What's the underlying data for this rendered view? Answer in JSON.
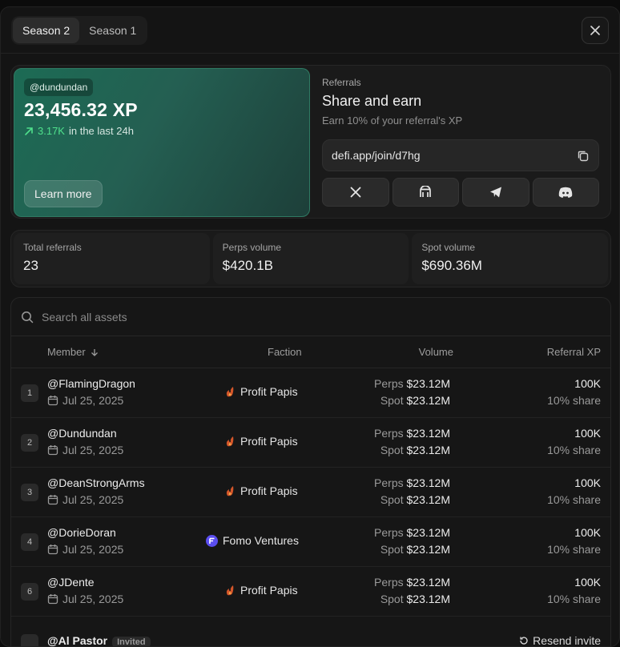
{
  "tabs": [
    {
      "label": "Season 2"
    },
    {
      "label": "Season 1"
    }
  ],
  "xp_card": {
    "handle": "@dundundan",
    "xp": "23,456.32 XP",
    "change_value": "3.17K",
    "change_suffix": "in the last 24h",
    "learn_more": "Learn more"
  },
  "referrals": {
    "label": "Referrals",
    "title": "Share and earn",
    "subtitle": "Earn 10% of your referral's XP",
    "link": "defi.app/join/d7hg",
    "share_icons": [
      "x-icon",
      "gateway-icon",
      "telegram-icon",
      "discord-icon"
    ]
  },
  "stats": [
    {
      "label": "Total referrals",
      "value": "23"
    },
    {
      "label": "Perps volume",
      "value": "$420.1B"
    },
    {
      "label": "Spot volume",
      "value": "$690.36M"
    }
  ],
  "search": {
    "placeholder": "Search all assets"
  },
  "columns": {
    "member": "Member",
    "faction": "Faction",
    "volume": "Volume",
    "xp": "Referral XP"
  },
  "volume_keys": {
    "perps": "Perps",
    "spot": "Spot"
  },
  "rows": [
    {
      "rank": "1",
      "member": "@FlamingDragon",
      "date": "Jul 25, 2025",
      "faction": "Profit Papis",
      "faction_icon": "flame-icon",
      "perps": "$23.12M",
      "spot": "$23.12M",
      "xp": "100K",
      "share": "10% share"
    },
    {
      "rank": "2",
      "member": "@Dundundan",
      "date": "Jul 25, 2025",
      "faction": "Profit Papis",
      "faction_icon": "flame-icon",
      "perps": "$23.12M",
      "spot": "$23.12M",
      "xp": "100K",
      "share": "10% share"
    },
    {
      "rank": "3",
      "member": "@DeanStrongArms",
      "date": "Jul 25, 2025",
      "faction": "Profit Papis",
      "faction_icon": "flame-icon",
      "perps": "$23.12M",
      "spot": "$23.12M",
      "xp": "100K",
      "share": "10% share"
    },
    {
      "rank": "4",
      "member": "@DorieDoran",
      "date": "Jul 25, 2025",
      "faction": "Fomo Ventures",
      "faction_icon": "fomo-icon",
      "perps": "$23.12M",
      "spot": "$23.12M",
      "xp": "100K",
      "share": "10% share"
    },
    {
      "rank": "6",
      "member": "@JDente",
      "date": "Jul 25, 2025",
      "faction": "Profit Papis",
      "faction_icon": "flame-icon",
      "perps": "$23.12M",
      "spot": "$23.12M",
      "xp": "100K",
      "share": "10% share"
    }
  ],
  "partial_row": {
    "member": "@Al Pastor",
    "badge": "Invited",
    "action": "Resend invite"
  }
}
